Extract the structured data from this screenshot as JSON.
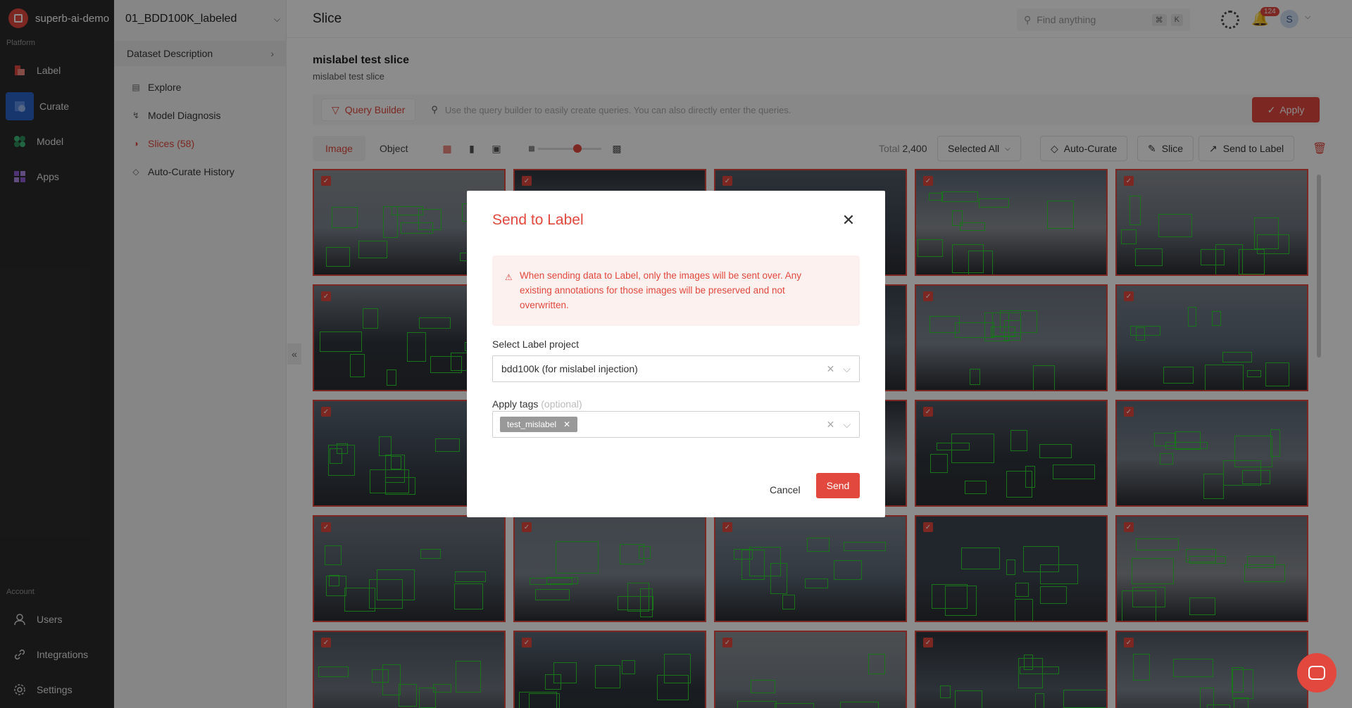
{
  "org": {
    "name": "superb-ai-demo"
  },
  "nav": {
    "platform_label": "Platform",
    "items": [
      {
        "label": "Label",
        "icon": "label-icon"
      },
      {
        "label": "Curate",
        "icon": "curate-icon"
      },
      {
        "label": "Model",
        "icon": "model-icon"
      },
      {
        "label": "Apps",
        "icon": "apps-icon"
      }
    ],
    "account_label": "Account",
    "account_items": [
      {
        "label": "Users",
        "icon": "user-icon"
      },
      {
        "label": "Integrations",
        "icon": "link-icon"
      },
      {
        "label": "Settings",
        "icon": "gear-icon"
      }
    ]
  },
  "dataset": {
    "name": "01_BDD100K_labeled",
    "description_label": "Dataset Description",
    "menu": [
      {
        "label": "Explore"
      },
      {
        "label": "Model Diagnosis"
      },
      {
        "label": "Slices (58)"
      },
      {
        "label": "Auto-Curate History"
      }
    ]
  },
  "header": {
    "title": "Slice",
    "search_placeholder": "Find anything",
    "shortcut_1": "⌘",
    "shortcut_2": "K",
    "notification_count": "124",
    "avatar_initial": "S"
  },
  "slice": {
    "name": "mislabel test slice",
    "description": "mislabel test slice"
  },
  "query": {
    "builder_label": "Query Builder",
    "hint": "Use the query builder to easily create queries. You can also directly enter the queries.",
    "apply_label": "Apply"
  },
  "toolbar": {
    "tabs": [
      "Image",
      "Object"
    ],
    "total_label": "Total",
    "total_value": "2,400",
    "selected_label": "Selected All",
    "auto_curate_label": "Auto-Curate",
    "slice_label": "Slice",
    "send_to_label": "Send to Label"
  },
  "modal": {
    "title": "Send to Label",
    "notice": "When sending data to Label, only the images will be sent over. Any existing annotations for those images will be preserved and not overwritten.",
    "project_label": "Select Label project",
    "project_value": "bdd100k (for mislabel injection)",
    "tags_label": "Apply tags",
    "tags_optional": "(optional)",
    "tags": [
      "test_mislabel"
    ],
    "cancel_label": "Cancel",
    "send_label": "Send"
  },
  "colors": {
    "accent": "#e2483d",
    "bbox": "#2fd62f",
    "nav_bg": "#2b2b2b"
  }
}
